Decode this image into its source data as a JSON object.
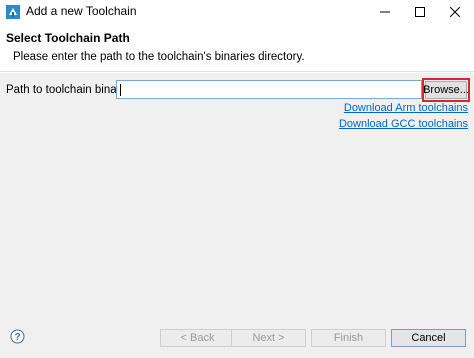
{
  "window": {
    "title": "Add a new Toolchain",
    "icons": {
      "app": "toolchain-app-icon",
      "minimize": "minimize-icon",
      "maximize": "maximize-icon",
      "close": "close-icon"
    }
  },
  "header": {
    "title": "Select Toolchain Path",
    "description": "Please enter the path to the toolchain's binaries directory."
  },
  "form": {
    "path_label": "Path to toolchain binaries:",
    "path_value": "",
    "path_placeholder": "",
    "browse_label": "Browse...",
    "highlight_color": "#d9262b"
  },
  "links": {
    "arm": "Download Arm toolchains",
    "gcc": "Download GCC toolchains",
    "link_color": "#0066cc"
  },
  "footer": {
    "help_icon": "help-icon",
    "back_label": "< Back",
    "next_label": "Next >",
    "finish_label": "Finish",
    "cancel_label": "Cancel"
  }
}
